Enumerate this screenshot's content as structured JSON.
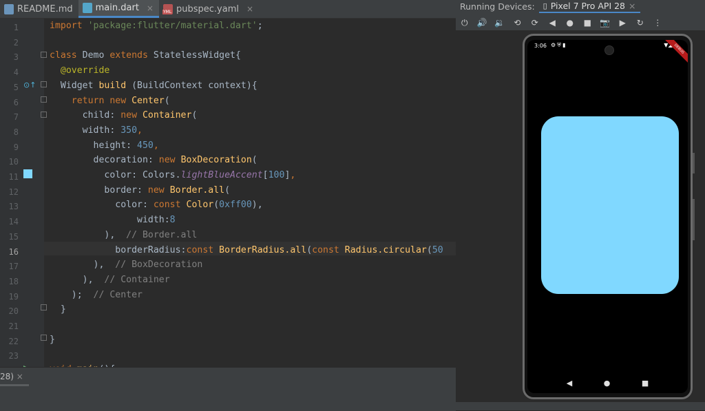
{
  "tabs": [
    {
      "label": "README.md",
      "icon": "markdown-file-icon",
      "active": false
    },
    {
      "label": "main.dart",
      "icon": "dart-file-icon",
      "active": true
    },
    {
      "label": "pubspec.yaml",
      "icon": "yaml-file-icon",
      "active": false
    }
  ],
  "close_glyph": "×",
  "line_numbers": [
    "1",
    "2",
    "3",
    "4",
    "5",
    "6",
    "7",
    "8",
    "9",
    "10",
    "11",
    "12",
    "13",
    "14",
    "15",
    "16",
    "17",
    "18",
    "19",
    "20",
    "21",
    "22",
    "23"
  ],
  "bottom": {
    "tab_label": "28)"
  },
  "devices": {
    "panel_title": "Running Devices:",
    "device_tab": "Pixel 7 Pro API 28",
    "status_time": "3:06",
    "container_color": "#80d8ff",
    "toolbar_icons": [
      "power-icon",
      "volume-up-icon",
      "volume-down-icon",
      "rotate-left-icon",
      "rotate-right-icon",
      "back-icon",
      "home-icon",
      "overview-icon",
      "screenshot-icon",
      "record-icon",
      "reset-icon",
      "more-icon"
    ]
  }
}
